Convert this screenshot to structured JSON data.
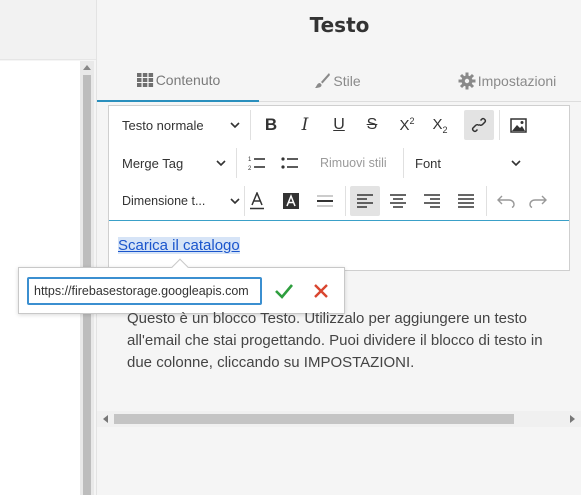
{
  "panel": {
    "title": "Testo"
  },
  "tabs": [
    {
      "label": "Contenuto",
      "icon": "grid-icon",
      "active": true
    },
    {
      "label": "Stile",
      "icon": "brush-icon",
      "active": false
    },
    {
      "label": "Impostazioni",
      "icon": "gear-icon",
      "active": false
    }
  ],
  "toolbar": {
    "block_style": "Testo normale",
    "merge_tag": "Merge Tag",
    "remove_styles": "Rimuovi stili",
    "font": "Font",
    "size": "Dimensione t...",
    "superscript": "2",
    "subscript": "2"
  },
  "editor": {
    "link_text": "Scarica il catalogo"
  },
  "link_popup": {
    "url": "https://firebasestorage.googleapis.com"
  },
  "help": {
    "text": "Questo è un blocco Testo. Utilizzalo per aggiungere un testo all'email che stai progettando. Puoi dividere il blocco di testo in due colonne, cliccando su IMPOSTAZIONI."
  },
  "colors": {
    "accent": "#2a8fbd",
    "link": "#1a55cc",
    "confirm": "#2e9e3e",
    "cancel": "#d9452f"
  }
}
